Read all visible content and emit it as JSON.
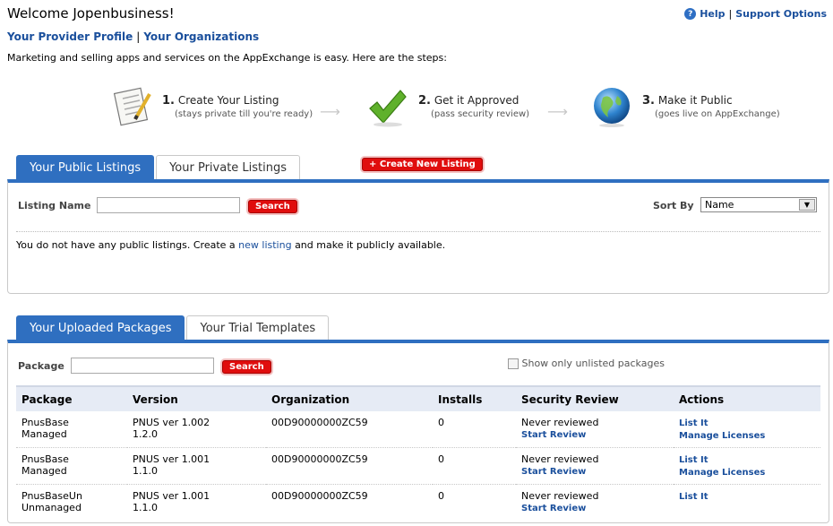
{
  "header": {
    "welcome": "Welcome Jopenbusiness!",
    "help_label": "Help",
    "support_label": "Support Options",
    "separator": "|"
  },
  "provider_links": {
    "profile": "Your Provider Profile",
    "organizations": "Your Organizations"
  },
  "intro_text": "Marketing and selling apps and services on the AppExchange is easy. Here are the steps:",
  "steps": [
    {
      "num": "1.",
      "title": "Create Your Listing",
      "sub": "(stays private till you're ready)",
      "icon": "document-icon"
    },
    {
      "num": "2.",
      "title": "Get it Approved",
      "sub": "(pass security review)",
      "icon": "checkmark-icon"
    },
    {
      "num": "3.",
      "title": "Make it Public",
      "sub": "(goes live on AppExchange)",
      "icon": "globe-icon"
    }
  ],
  "arrow_glyph": "⟶",
  "listing_tabs": [
    "Your Public Listings",
    "Your Private Listings"
  ],
  "create_listing_label": "+ Create New Listing",
  "listing_panel": {
    "name_label": "Listing Name",
    "name_value": "",
    "search_label": "Search",
    "sort_label": "Sort By",
    "sort_value": "Name",
    "empty_prefix": "You do not have any public listings. Create a",
    "empty_link": "new listing",
    "empty_suffix": "and make it publicly available."
  },
  "package_tabs": [
    "Your Uploaded Packages",
    "Your Trial Templates"
  ],
  "package_panel": {
    "package_label": "Package",
    "package_value": "",
    "search_label": "Search",
    "checkbox_label": "Show only unlisted packages",
    "columns": [
      "Package",
      "Version",
      "Organization",
      "Installs",
      "Security Review",
      "Actions"
    ],
    "rows": [
      {
        "name1": "PnusBase",
        "name2": "Managed",
        "ver1": "PNUS ver 1.002",
        "ver2": "1.2.0",
        "org": "00D90000000ZC59",
        "installs": "0",
        "review": "Never reviewed",
        "review_link": "Start Review",
        "action1": "List It",
        "action2": "Manage Licenses"
      },
      {
        "name1": "PnusBase",
        "name2": "Managed",
        "ver1": "PNUS ver 1.001",
        "ver2": "1.1.0",
        "org": "00D90000000ZC59",
        "installs": "0",
        "review": "Never reviewed",
        "review_link": "Start Review",
        "action1": "List It",
        "action2": "Manage Licenses"
      },
      {
        "name1": "PnusBaseUn",
        "name2": "Unmanaged",
        "ver1": "PNUS ver 1.001",
        "ver2": "1.1.0",
        "org": "00D90000000ZC59",
        "installs": "0",
        "review": "Never reviewed",
        "review_link": "Start Review",
        "action1": "List It",
        "action2": ""
      }
    ]
  },
  "colors": {
    "accent": "#2f6fc0",
    "button_red": "#e00d0d",
    "link": "#1a4f9c"
  }
}
